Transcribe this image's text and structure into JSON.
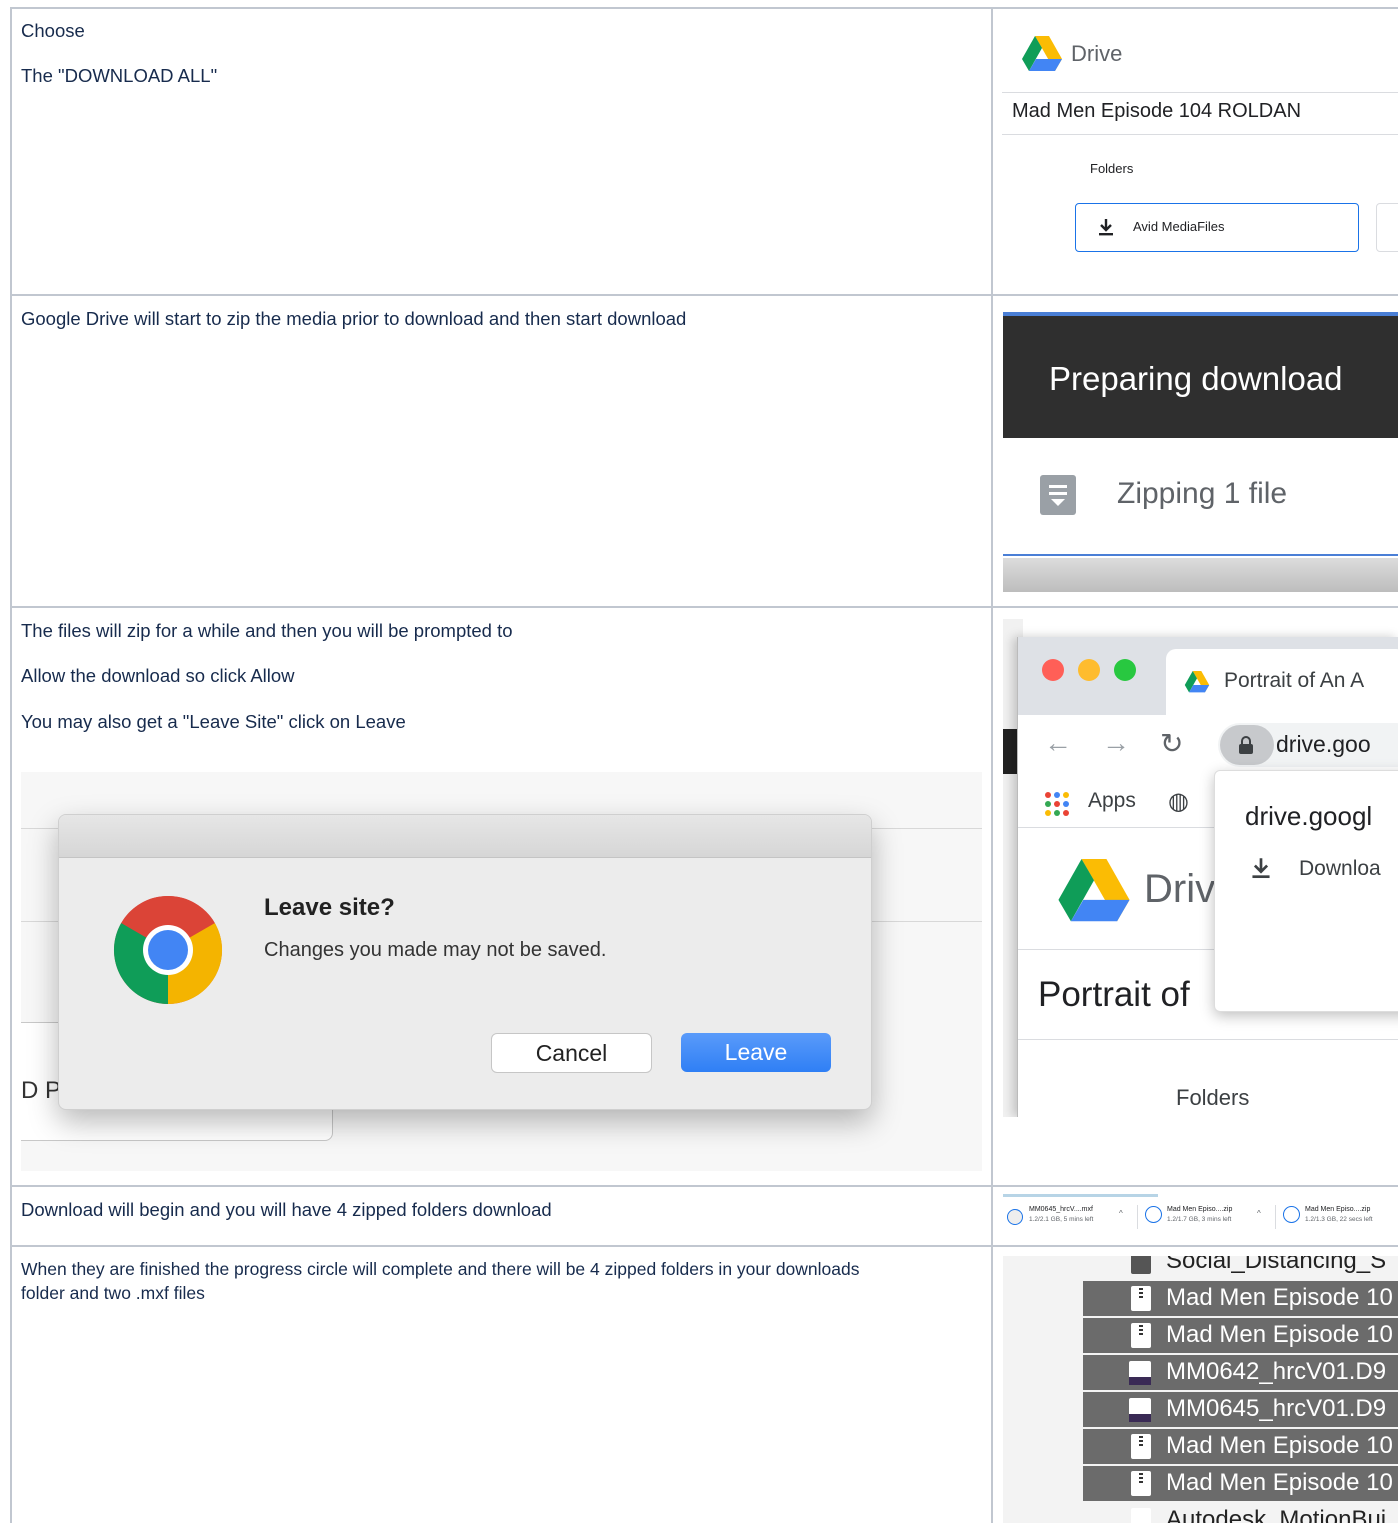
{
  "rows": [
    {
      "text": [
        "Choose",
        "The \"DOWNLOAD ALL\""
      ],
      "drive": {
        "brand": "Drive",
        "title": "Mad Men Episode 104 ROLDAN",
        "folders_label": "Folders",
        "folder_button": "Avid MediaFiles"
      }
    },
    {
      "text": [
        "Google Drive will start to zip the media prior to download and then start download"
      ],
      "preparing": {
        "heading": "Preparing download",
        "status": "Zipping 1 file"
      }
    },
    {
      "text": [
        "The files will zip for a while and then you will be prompted to",
        "Allow the download so click Allow",
        "You may also get a \"Leave Site\" click on Leave"
      ],
      "dialog": {
        "title": "Leave site?",
        "message": "Changes you made may not be saved.",
        "cancel": "Cancel",
        "leave": "Leave",
        "bg_fragment": "D Pr"
      },
      "browser": {
        "tab_title": "Portrait of An A",
        "url": "drive.goo",
        "apps": "Apps",
        "popup_host": "drive.googl",
        "popup_download": "Downloa",
        "brand_fragment": "Driv",
        "page_title_fragment": "Portrait of",
        "folders_label": "Folders"
      }
    },
    {
      "text": [
        "Download will begin and you will have 4 zipped folders download"
      ],
      "downloads": [
        {
          "name": "MM0645_hrcV....mxf",
          "status": "1.2/2.1 GB, 5 mins left"
        },
        {
          "name": "Mad Men Episo....zip",
          "status": "1.2/1.7 GB, 3 mins left"
        },
        {
          "name": "Mad Men Episo....zip",
          "status": "1.2/1.3 GB, 22 secs left"
        }
      ]
    },
    {
      "text": [
        "When they are finished the progress circle will complete and there will be 4 zipped folders in your downloads folder and two .mxf files"
      ],
      "files": [
        {
          "name": "Social_Distancing_S",
          "kind": "folder",
          "selected": false
        },
        {
          "name": "Mad Men Episode 10",
          "kind": "zip",
          "selected": true
        },
        {
          "name": "Mad Men Episode 10",
          "kind": "zip",
          "selected": true
        },
        {
          "name": "MM0642_hrcV01.D9",
          "kind": "mxf",
          "selected": true
        },
        {
          "name": "MM0645_hrcV01.D9",
          "kind": "mxf",
          "selected": true
        },
        {
          "name": "Mad Men Episode 10",
          "kind": "zip",
          "selected": true
        },
        {
          "name": "Mad Men Episode 10",
          "kind": "zip",
          "selected": true
        },
        {
          "name": "Autodesk_MotionBui",
          "kind": "file",
          "selected": false
        }
      ]
    }
  ],
  "colors": {
    "border": "#c1c7d0",
    "text": "#172b4d",
    "leave_blue": "#2f7ff5",
    "selected_row": "#6b6b6b"
  },
  "icons": [
    "drive-logo-icon",
    "download-icon",
    "file-doc-icon",
    "chrome-logo-icon",
    "lock-icon",
    "apps-grid-icon",
    "globe-icon",
    "back-icon",
    "forward-icon",
    "reload-icon",
    "zip-icon",
    "mxf-icon",
    "progress-circle-icon"
  ]
}
